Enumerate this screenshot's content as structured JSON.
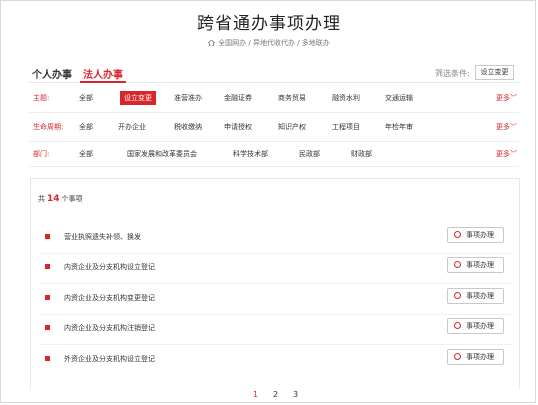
{
  "header": {
    "title": "跨省通办事项办理",
    "breadcrumb": "全国网办 / 异地代收代办 / 多地联办"
  },
  "tabs": [
    {
      "label": "个人办事",
      "active": false
    },
    {
      "label": "法人办事",
      "active": true
    }
  ],
  "filter": {
    "label": "筛选条件:",
    "selected": "设立变更"
  },
  "filter_rows": [
    {
      "label": "主题:",
      "options": [
        "全部",
        "设立变更",
        "准营准办",
        "金融证券",
        "商务贸易",
        "融资水利",
        "交通运输"
      ],
      "selected_index": 1,
      "more": "更多"
    },
    {
      "label": "生命周期:",
      "options": [
        "全部",
        "开办企业",
        "税收缴纳",
        "申请授权",
        "知识产权",
        "工程项目",
        "年检年审"
      ],
      "selected_index": -1,
      "more": "更多"
    },
    {
      "label": "部门:",
      "options": [
        "全部",
        "国家发展和改革委员会",
        "科学技术部",
        "民政部",
        "财政部"
      ],
      "selected_index": -1,
      "more": "更多"
    }
  ],
  "results": {
    "prefix": "共",
    "count": "14",
    "suffix": "个事项",
    "items": [
      {
        "name": "营业执照遗失补领、换发",
        "action": "事项办理"
      },
      {
        "name": "内资企业及分支机构设立登记",
        "action": "事项办理"
      },
      {
        "name": "内资企业及分支机构变更登记",
        "action": "事项办理"
      },
      {
        "name": "内资企业及分支机构注销登记",
        "action": "事项办理"
      },
      {
        "name": "外资企业及分支机构设立登记",
        "action": "事项办理"
      }
    ]
  },
  "pagination": {
    "pages": [
      "1",
      "2",
      "3"
    ],
    "current": "1"
  },
  "colors": {
    "accent": "#d9262b",
    "text": "#333333",
    "muted": "#888888",
    "border": "#e6e6e6"
  }
}
